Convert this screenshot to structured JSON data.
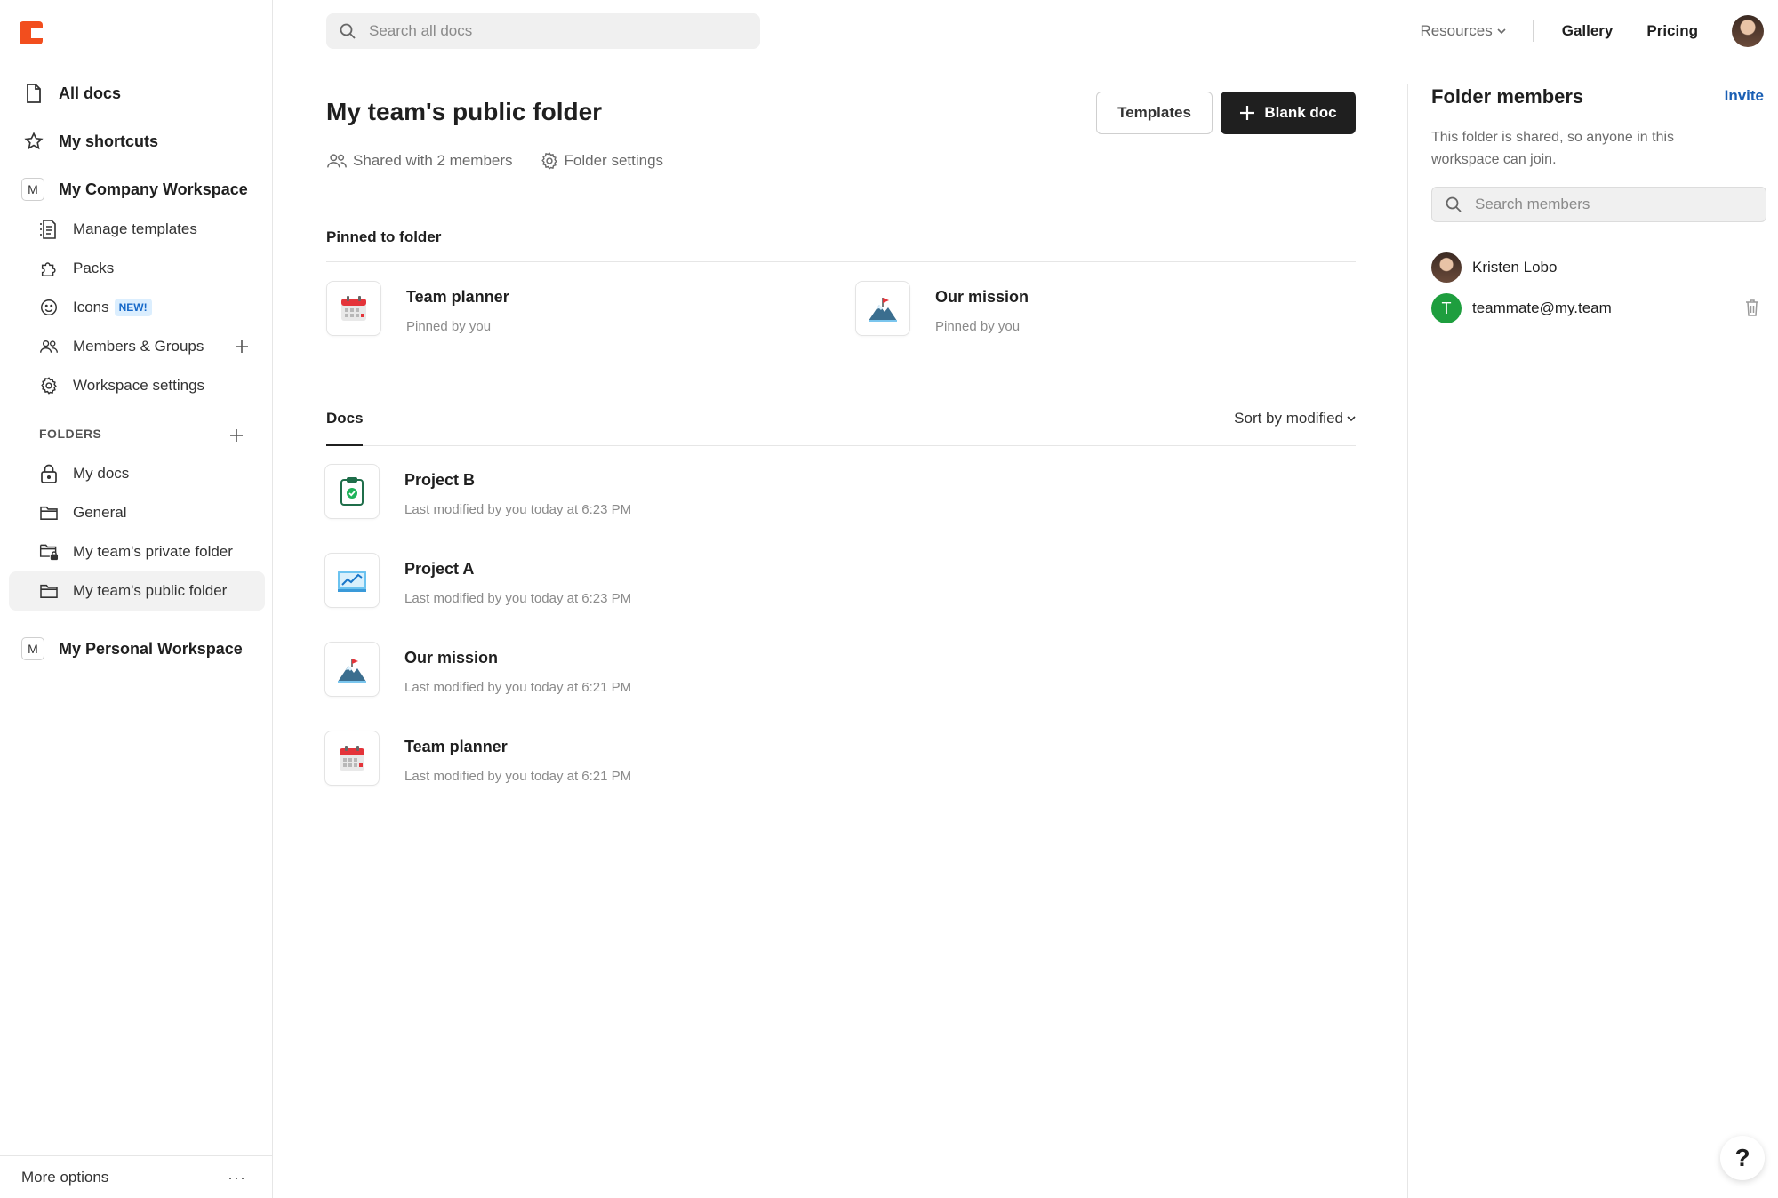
{
  "sidebar": {
    "all_docs": "All docs",
    "my_shortcuts": "My shortcuts",
    "company_workspace": {
      "badge": "M",
      "name": "My Company Workspace"
    },
    "workspace_items": [
      {
        "label": "Manage templates",
        "icon": "template-icon"
      },
      {
        "label": "Packs",
        "icon": "puzzle-icon"
      },
      {
        "label": "Icons",
        "icon": "smiley-icon",
        "badge": "NEW!"
      },
      {
        "label": "Members & Groups",
        "icon": "people-icon"
      },
      {
        "label": "Workspace settings",
        "icon": "gear-icon"
      }
    ],
    "folders_header": "FOLDERS",
    "folders": [
      {
        "label": "My docs",
        "icon": "lock-icon"
      },
      {
        "label": "General",
        "icon": "folder-icon"
      },
      {
        "label": "My team's private folder",
        "icon": "folder-lock-icon"
      },
      {
        "label": "My team's public folder",
        "icon": "folder-icon",
        "active": true
      }
    ],
    "personal_workspace": {
      "badge": "M",
      "name": "My Personal Workspace"
    },
    "more_options": "More options",
    "more_dots": "···"
  },
  "topbar": {
    "search_placeholder": "Search all docs",
    "resources": "Resources",
    "gallery": "Gallery",
    "pricing": "Pricing"
  },
  "main": {
    "title": "My team's public folder",
    "shared_with": "Shared with 2 members",
    "folder_settings": "Folder settings",
    "templates_button": "Templates",
    "blank_doc_button": "Blank doc",
    "pinned_label": "Pinned to folder",
    "pinned": [
      {
        "title": "Team planner",
        "sub": "Pinned by you",
        "icon": "calendar-icon"
      },
      {
        "title": "Our mission",
        "sub": "Pinned by you",
        "icon": "mountain-flag-icon"
      }
    ],
    "docs_tab": "Docs",
    "sort": "Sort by modified",
    "docs": [
      {
        "title": "Project B",
        "sub": "Last modified by you today at 6:23 PM",
        "icon": "clipboard-check-icon"
      },
      {
        "title": "Project A",
        "sub": "Last modified by you today at 6:23 PM",
        "icon": "chart-icon"
      },
      {
        "title": "Our mission",
        "sub": "Last modified by you today at 6:21 PM",
        "icon": "mountain-flag-icon"
      },
      {
        "title": "Team planner",
        "sub": "Last modified by you today at 6:21 PM",
        "icon": "calendar-icon"
      }
    ]
  },
  "panel": {
    "title": "Folder members",
    "invite": "Invite",
    "description": "This folder is shared, so anyone in this workspace can join.",
    "search_placeholder": "Search members",
    "members": [
      {
        "name": "Kristen Lobo",
        "avatar": "photo"
      },
      {
        "name": "teammate@my.team",
        "initial": "T",
        "color": "#1e9e3e"
      }
    ]
  },
  "help": "?",
  "colors": {
    "brand": "#f24e1e",
    "primary_button": "#1f1f1f",
    "link": "#1a5fb4",
    "new_badge_bg": "#dbeefe"
  }
}
